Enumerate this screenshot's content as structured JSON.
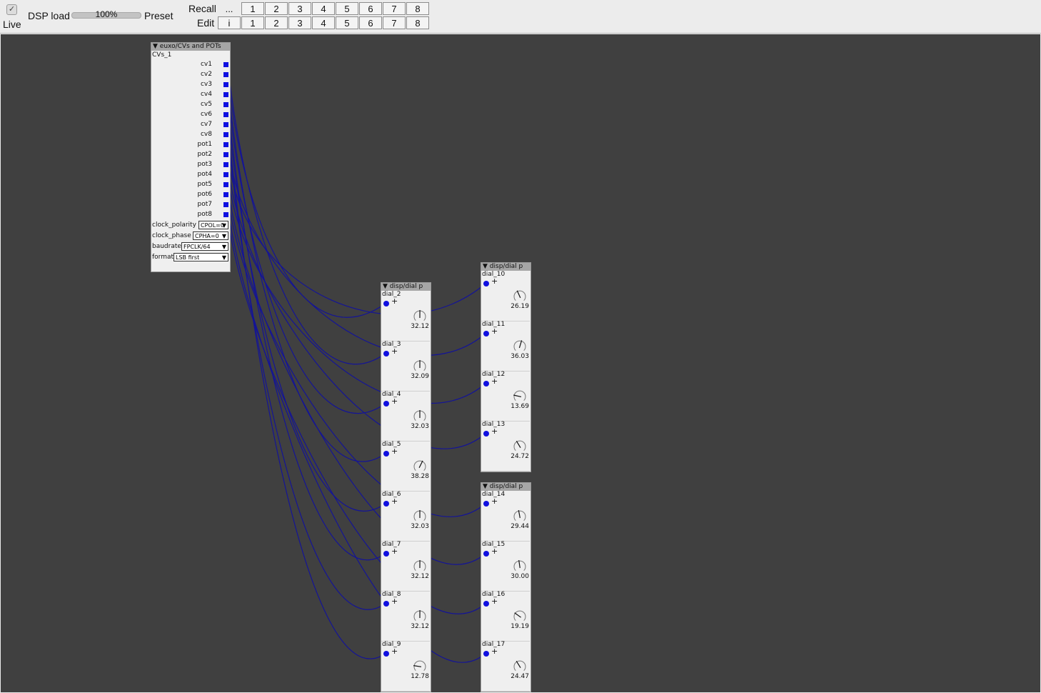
{
  "toolbar": {
    "live_label": "Live",
    "live_checked": true,
    "dsp_label": "DSP load",
    "dsp_value": "100%",
    "dsp_fraction": 1.0,
    "preset_label": "Preset",
    "recall_label": "Recall",
    "recall_more": "...",
    "edit_label": "Edit",
    "edit_info": "i",
    "preset_buttons": [
      "1",
      "2",
      "3",
      "4",
      "5",
      "6",
      "7",
      "8"
    ]
  },
  "module": {
    "title": "euxo/CVs and POTs",
    "instance": "CVs_1",
    "outlets": [
      "cv1",
      "cv2",
      "cv3",
      "cv4",
      "cv5",
      "cv6",
      "cv7",
      "cv8",
      "pot1",
      "pot2",
      "pot3",
      "pot4",
      "pot5",
      "pot6",
      "pot7",
      "pot8"
    ],
    "params": [
      {
        "label": "clock_polarity",
        "value": "CPOL=0"
      },
      {
        "label": "clock_phase",
        "value": "CPHA=0"
      },
      {
        "label": "baudrate",
        "value": "FPCLK/64"
      },
      {
        "label": "format",
        "value": "LSB first"
      }
    ]
  },
  "groups": [
    {
      "title": "disp/dial p",
      "dials": [
        {
          "name": "dial_2",
          "value": "32.12",
          "v": 32.12
        },
        {
          "name": "dial_3",
          "value": "32.09",
          "v": 32.09
        },
        {
          "name": "dial_4",
          "value": "32.03",
          "v": 32.03
        },
        {
          "name": "dial_5",
          "value": "38.28",
          "v": 38.28
        },
        {
          "name": "dial_6",
          "value": "32.03",
          "v": 32.03
        },
        {
          "name": "dial_7",
          "value": "32.12",
          "v": 32.12
        },
        {
          "name": "dial_8",
          "value": "32.12",
          "v": 32.12
        },
        {
          "name": "dial_9",
          "value": "12.78",
          "v": 12.78
        }
      ]
    },
    {
      "title": "disp/dial p",
      "dials": [
        {
          "name": "dial_10",
          "value": "26.19",
          "v": 26.19
        },
        {
          "name": "dial_11",
          "value": "36.03",
          "v": 36.03
        },
        {
          "name": "dial_12",
          "value": "13.69",
          "v": 13.69
        },
        {
          "name": "dial_13",
          "value": "24.72",
          "v": 24.72
        }
      ]
    },
    {
      "title": "disp/dial p",
      "dials": [
        {
          "name": "dial_14",
          "value": "29.44",
          "v": 29.44
        },
        {
          "name": "dial_15",
          "value": "30.00",
          "v": 30.0
        },
        {
          "name": "dial_16",
          "value": "19.19",
          "v": 19.19
        },
        {
          "name": "dial_17",
          "value": "24.47",
          "v": 24.47
        }
      ]
    }
  ],
  "colors": {
    "canvas": "#404040",
    "wire": "#141496",
    "outlet": "#1010e0"
  }
}
